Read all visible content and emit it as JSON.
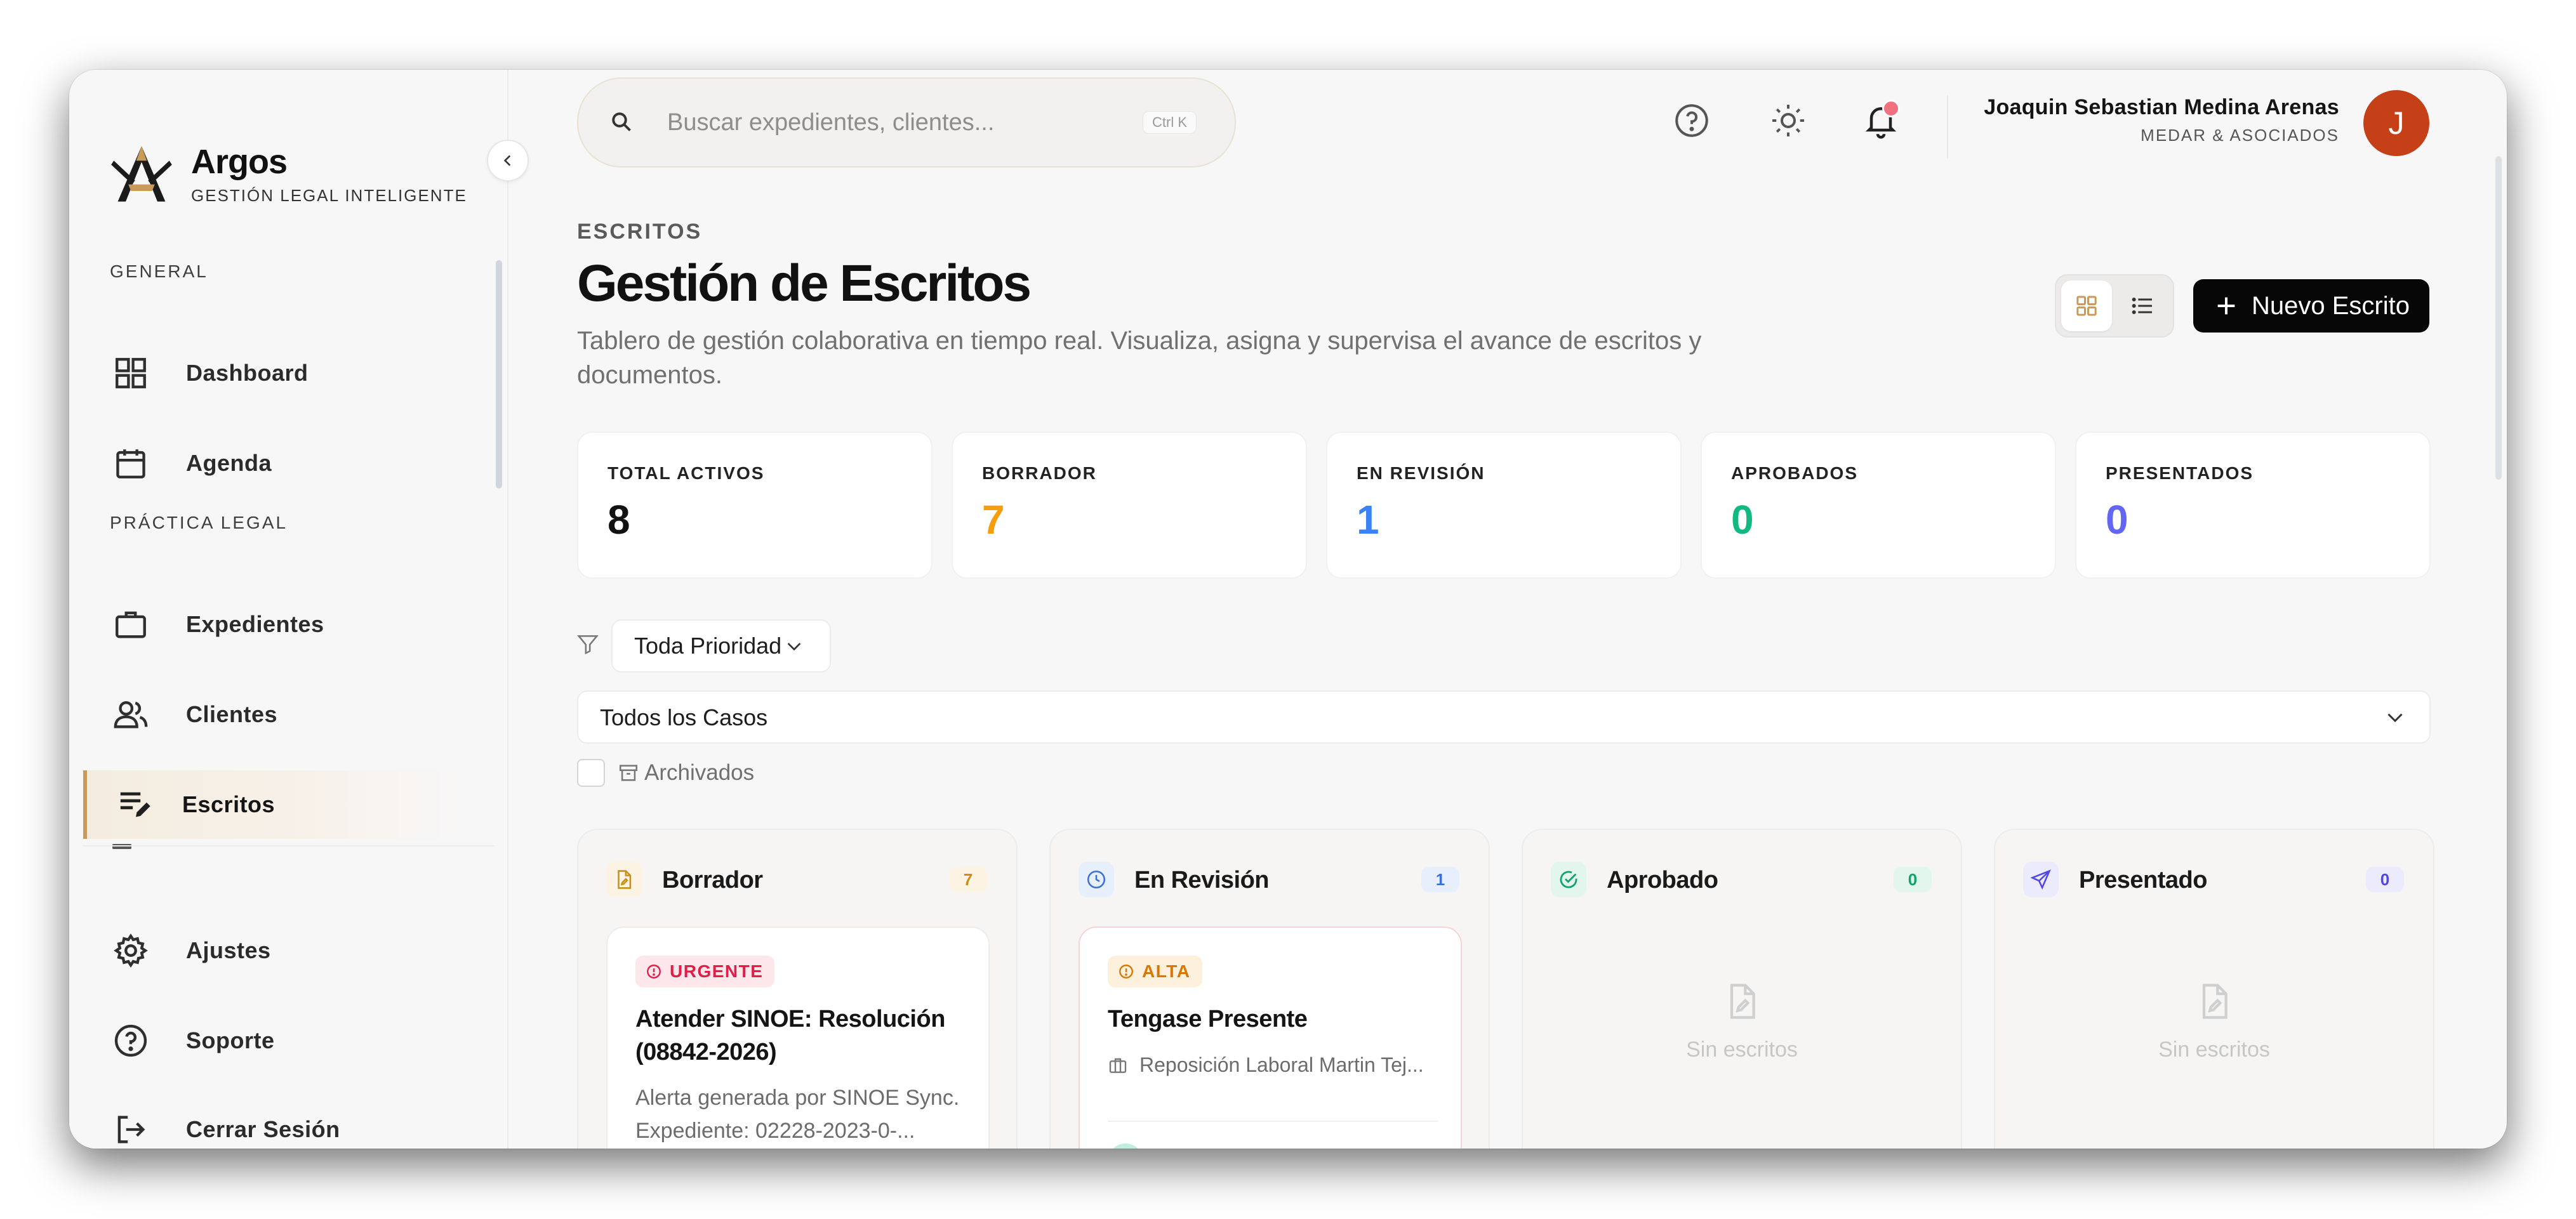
{
  "app": {
    "name": "Argos",
    "tagline": "GESTIÓN LEGAL INTELIGENTE"
  },
  "sidebar": {
    "sections": [
      {
        "label": "GENERAL"
      },
      {
        "label": "PRÁCTICA LEGAL"
      }
    ],
    "items": [
      {
        "label": "Dashboard",
        "icon": "grid-icon"
      },
      {
        "label": "Agenda",
        "icon": "calendar-icon"
      },
      {
        "label": "Expedientes",
        "icon": "briefcase-icon"
      },
      {
        "label": "Clientes",
        "icon": "users-icon"
      },
      {
        "label": "Escritos",
        "icon": "edit-document-icon",
        "active": true
      }
    ],
    "bottom_items": [
      {
        "label": "Ajustes",
        "icon": "gear-icon"
      },
      {
        "label": "Soporte",
        "icon": "help-circle-icon"
      },
      {
        "label": "Cerrar Sesión",
        "icon": "logout-icon"
      }
    ]
  },
  "topbar": {
    "search_placeholder": "Buscar expedientes, clientes...",
    "search_shortcut": "Ctrl K",
    "user_name": "Joaquin Sebastian Medina Arenas",
    "user_org": "MEDAR & ASOCIADOS",
    "avatar_initial": "J"
  },
  "page": {
    "breadcrumb": "ESCRITOS",
    "title": "Gestión de Escritos",
    "description": "Tablero de gestión colaborativa en tiempo real. Visualiza, asigna y supervisa el avance de escritos y documentos.",
    "new_button": "Nuevo Escrito"
  },
  "stats": [
    {
      "label": "TOTAL ACTIVOS",
      "value": "8",
      "color": "#111111"
    },
    {
      "label": "BORRADOR",
      "value": "7",
      "color": "#f59e0b"
    },
    {
      "label": "EN REVISIÓN",
      "value": "1",
      "color": "#3b82f6"
    },
    {
      "label": "APROBADOS",
      "value": "0",
      "color": "#10b981"
    },
    {
      "label": "PRESENTADOS",
      "value": "0",
      "color": "#6366f1"
    }
  ],
  "filters": {
    "priority": "Toda Prioridad",
    "cases": "Todos los Casos",
    "archived_label": "Archivados"
  },
  "columns": [
    {
      "title": "Borrador",
      "count": "7",
      "icon": "document-edit-icon",
      "accent": "#c8901a",
      "accent_bg": "#fdf3e2",
      "card": {
        "badge": "URGENTE",
        "badge_color": "#e11d48",
        "badge_bg": "#fde7ea",
        "title": "Atender SINOE: Resolución (08842-2026)",
        "description": "Alerta generada por SINOE Sync. Expediente: 02228-2023-0-..."
      }
    },
    {
      "title": "En Revisión",
      "count": "1",
      "icon": "clock-icon",
      "accent": "#3b6fd8",
      "accent_bg": "#e7effc",
      "card": {
        "badge": "ALTA",
        "badge_color": "#d97706",
        "badge_bg": "#fdf1de",
        "title": "Tengase Presente",
        "case": "Reposición Laboral Martin Tej..."
      }
    },
    {
      "title": "Aprobado",
      "count": "0",
      "icon": "check-circle-icon",
      "accent": "#10a36e",
      "accent_bg": "#e3f6ee",
      "empty": "Sin escritos"
    },
    {
      "title": "Presentado",
      "count": "0",
      "icon": "send-icon",
      "accent": "#4f46e5",
      "accent_bg": "#eceafd",
      "empty": "Sin escritos"
    }
  ],
  "colors": {
    "accent_gold": "#c89b5a",
    "primary_button": "#070707",
    "avatar_bg": "#c53f17",
    "notification_dot": "#f0727f"
  }
}
